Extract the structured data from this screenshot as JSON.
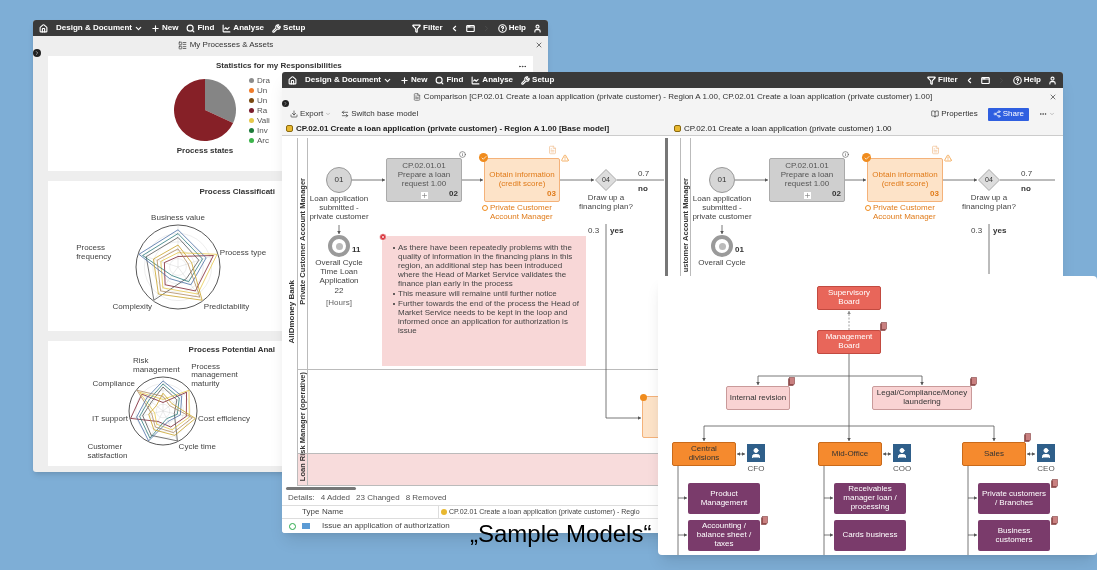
{
  "caption": "„Sample Models“",
  "dashboard": {
    "toolbar": [
      {
        "kind": "home"
      },
      {
        "kind": "dropdown",
        "label": "Design & Document"
      },
      {
        "kind": "new",
        "label": "New"
      },
      {
        "kind": "find",
        "label": "Find"
      },
      {
        "kind": "analyse",
        "label": "Analyse"
      },
      {
        "kind": "setup",
        "label": "Setup"
      }
    ],
    "toolbar_right": [
      {
        "kind": "filter",
        "label": "Filter",
        "disabled": false
      },
      {
        "kind": "back",
        "disabled": false
      },
      {
        "kind": "window",
        "disabled": false
      },
      {
        "kind": "forward",
        "disabled": true
      },
      {
        "kind": "help",
        "label": "Help",
        "disabled": false
      },
      {
        "kind": "user",
        "disabled": false
      }
    ],
    "title": "My Processes & Assets",
    "statistics": {
      "title": "Statistics for my Responsibilities",
      "chart_label": "Process states",
      "legend": [
        {
          "label": "Dra",
          "color": "#8c8c8c"
        },
        {
          "label": "Un",
          "color": "#f07c2a"
        },
        {
          "label": "Un",
          "color": "#7a4a12"
        },
        {
          "label": "Ra",
          "color": "#7b1e2e"
        },
        {
          "label": "Vali",
          "color": "#e6c84a"
        },
        {
          "label": "Inv",
          "color": "#1d7a3a"
        },
        {
          "label": "Arc",
          "color": "#3cb44b"
        }
      ]
    },
    "classification": {
      "title": "Process Classificati",
      "axes": [
        "Business value",
        "Process frequency",
        "Process type",
        "Complexity",
        "Predictability"
      ]
    },
    "potential": {
      "title": "Process Potential Anal",
      "axes": [
        "Risk management",
        "Compliance",
        "Process management maturity",
        "IT support",
        "Cost efficiency",
        "Customer satisfaction",
        "Cycle time"
      ]
    }
  },
  "comparison": {
    "toolbar": [
      {
        "kind": "home"
      },
      {
        "kind": "dropdown",
        "label": "Design & Document"
      },
      {
        "kind": "new",
        "label": "New"
      },
      {
        "kind": "find",
        "label": "Find"
      },
      {
        "kind": "analyse",
        "label": "Analyse"
      },
      {
        "kind": "setup",
        "label": "Setup"
      }
    ],
    "toolbar_right": [
      {
        "kind": "filter",
        "label": "Filter",
        "disabled": false
      },
      {
        "kind": "back",
        "disabled": false
      },
      {
        "kind": "window",
        "disabled": false
      },
      {
        "kind": "forward",
        "disabled": true
      },
      {
        "kind": "help",
        "label": "Help",
        "disabled": false
      },
      {
        "kind": "user",
        "disabled": false
      }
    ],
    "title": "Comparison [CP.02.01 Create a loan application (private customer) - Region A 1.00, CP.02.01 Create a loan application (private customer) 1.00]",
    "actions": [
      {
        "kind": "export",
        "label": "Export"
      },
      {
        "kind": "switch",
        "label": "Switch base model"
      }
    ],
    "actions_right": [
      {
        "kind": "properties",
        "label": "Properties"
      },
      {
        "kind": "share",
        "label": "Share"
      },
      {
        "kind": "more"
      }
    ],
    "panes": [
      {
        "header": "CP.02.01 Create a loan application (private customer) - Region A 1.00 [Base model]",
        "base": true,
        "pool": "AllDmoney Bank",
        "lanes": [
          {
            "kind": "normal",
            "label": "Private Customer Account Manager"
          },
          {
            "kind": "normal",
            "label": "Loan Risk Manager (operative)"
          },
          {
            "kind": "changed"
          }
        ],
        "start_event": {
          "number": "01",
          "label": "Loan application submitted - private customer"
        },
        "task": {
          "label": "CP.02.01.01 Prepare a loan request 1.00",
          "number": "02"
        },
        "changed_task": {
          "label": "Obtain information (credit score)",
          "number": "03",
          "role": "Private Customer Account Manager"
        },
        "gateway": {
          "number": "04",
          "label": "Draw up a financing plan?",
          "no_share": "0.7",
          "no_label": "no",
          "yes_share": "0.3",
          "yes_label": "yes"
        },
        "timer": {
          "number": "11",
          "label": "Overall Cycle Time Loan Application",
          "value": "22",
          "unit": "[Hours]"
        },
        "note": {
          "items": [
            "As there have been repeatedly problems with the quality of information in the financing plans in this region, an additional step has been introduced where the Head of Market Service validates the finance plan early in the process",
            "This measure will remaine until further notice",
            "Further towards the end of the process the Head of Market Service needs to be kept in the loop and informed once an application for authorization is issue"
          ]
        },
        "second_task": {
          "kind": "changed"
        }
      },
      {
        "header": "CP.02.01 Create a loan application (private customer) 1.00",
        "base": false,
        "lanes": [
          {
            "kind": "normal",
            "label": "ustomer Account Manager"
          }
        ],
        "start_event": {
          "number": "01",
          "label": "Loan application submitted - private customer"
        },
        "task": {
          "label": "CP.02.01.01 Prepare a loan request 1.00",
          "number": "02"
        },
        "changed_task": {
          "label": "Obtain information (credit score)",
          "number": "03",
          "role": "Private Customer Account Manager"
        },
        "gateway": {
          "number": "04",
          "label": "Draw up a financing plan?",
          "no_share": "0.7",
          "no_label": "no",
          "yes_share": "0.3",
          "yes_label": "yes"
        },
        "timer": {
          "number": "01",
          "label": "Overall Cycle"
        }
      }
    ],
    "details": {
      "label": "Details:",
      "counts": [
        "4 Added",
        "23 Changed",
        "8 Removed"
      ]
    },
    "table": {
      "columns": [
        "Type",
        "Name",
        "CP.02.01 Create a loan application (private customer) - Regio"
      ],
      "rows": [
        {
          "kind": "added",
          "name": "Issue an application of authorization"
        }
      ]
    }
  },
  "org_chart": {
    "top": [
      {
        "label": "Supervisory Board",
        "attachment": false
      },
      {
        "label": "Management Board",
        "attachment": true
      }
    ],
    "staff": [
      {
        "label": "Internal revision",
        "attachment": true
      },
      {
        "label": "Legal/Compliance/Money laundering",
        "attachment": true
      }
    ],
    "divisions": [
      {
        "label": "Central divisions",
        "head": "CFO",
        "attachment": false,
        "units": [
          {
            "label": "Product Management",
            "attachment": false
          },
          {
            "label": "Accounting / balance sheet / taxes",
            "attachment": true
          }
        ]
      },
      {
        "label": "Mid-Office",
        "head": "COO",
        "attachment": false,
        "units": [
          {
            "label": "Receivables manager loan / processing",
            "attachment": false
          },
          {
            "label": "Cards business",
            "attachment": false
          }
        ]
      },
      {
        "label": "Sales",
        "head": "CEO",
        "attachment": true,
        "units": [
          {
            "label": "Private customers / Branches",
            "attachment": true
          },
          {
            "label": "Business customers",
            "attachment": true
          }
        ]
      }
    ]
  }
}
